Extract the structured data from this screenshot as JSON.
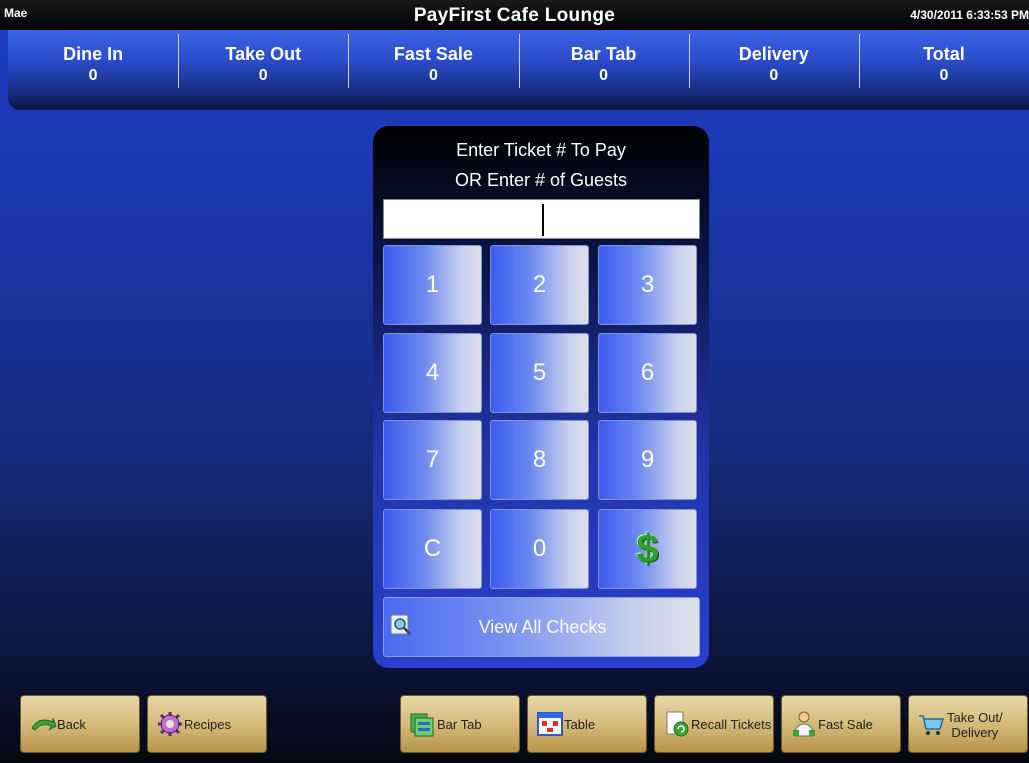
{
  "header": {
    "user": "Mae",
    "title": "PayFirst Cafe Lounge",
    "datetime": "4/30/2011 6:33:53 PM"
  },
  "stats": [
    {
      "label": "Dine In",
      "value": "0"
    },
    {
      "label": "Take Out",
      "value": "0"
    },
    {
      "label": "Fast Sale",
      "value": "0"
    },
    {
      "label": "Bar Tab",
      "value": "0"
    },
    {
      "label": "Delivery",
      "value": "0"
    },
    {
      "label": "Total",
      "value": "0"
    }
  ],
  "keypad": {
    "prompt_line1": "Enter Ticket # To Pay",
    "prompt_line2": "OR Enter # of Guests",
    "input_value": "",
    "keys": [
      "1",
      "2",
      "3",
      "4",
      "5",
      "6",
      "7",
      "8",
      "9",
      "C",
      "0",
      "$"
    ],
    "view_all_label": "View All Checks"
  },
  "bottom_buttons": {
    "back": "Back",
    "recipes": "Recipes",
    "bar_tab": "Bar Tab",
    "table": "Table",
    "recall_tickets": "Recall Tickets",
    "fast_sale": "Fast Sale",
    "take_out_line1": "Take Out/",
    "take_out_line2": "Delivery"
  },
  "icons": {
    "back": "back-arrow-icon",
    "recipes": "gear-icon",
    "bar_tab": "bar-tab-icon",
    "table": "table-icon",
    "recall": "recall-icon",
    "fast_sale": "person-icon",
    "take_out": "cart-icon",
    "view_checks": "magnifier-icon",
    "dollar": "dollar-icon"
  }
}
